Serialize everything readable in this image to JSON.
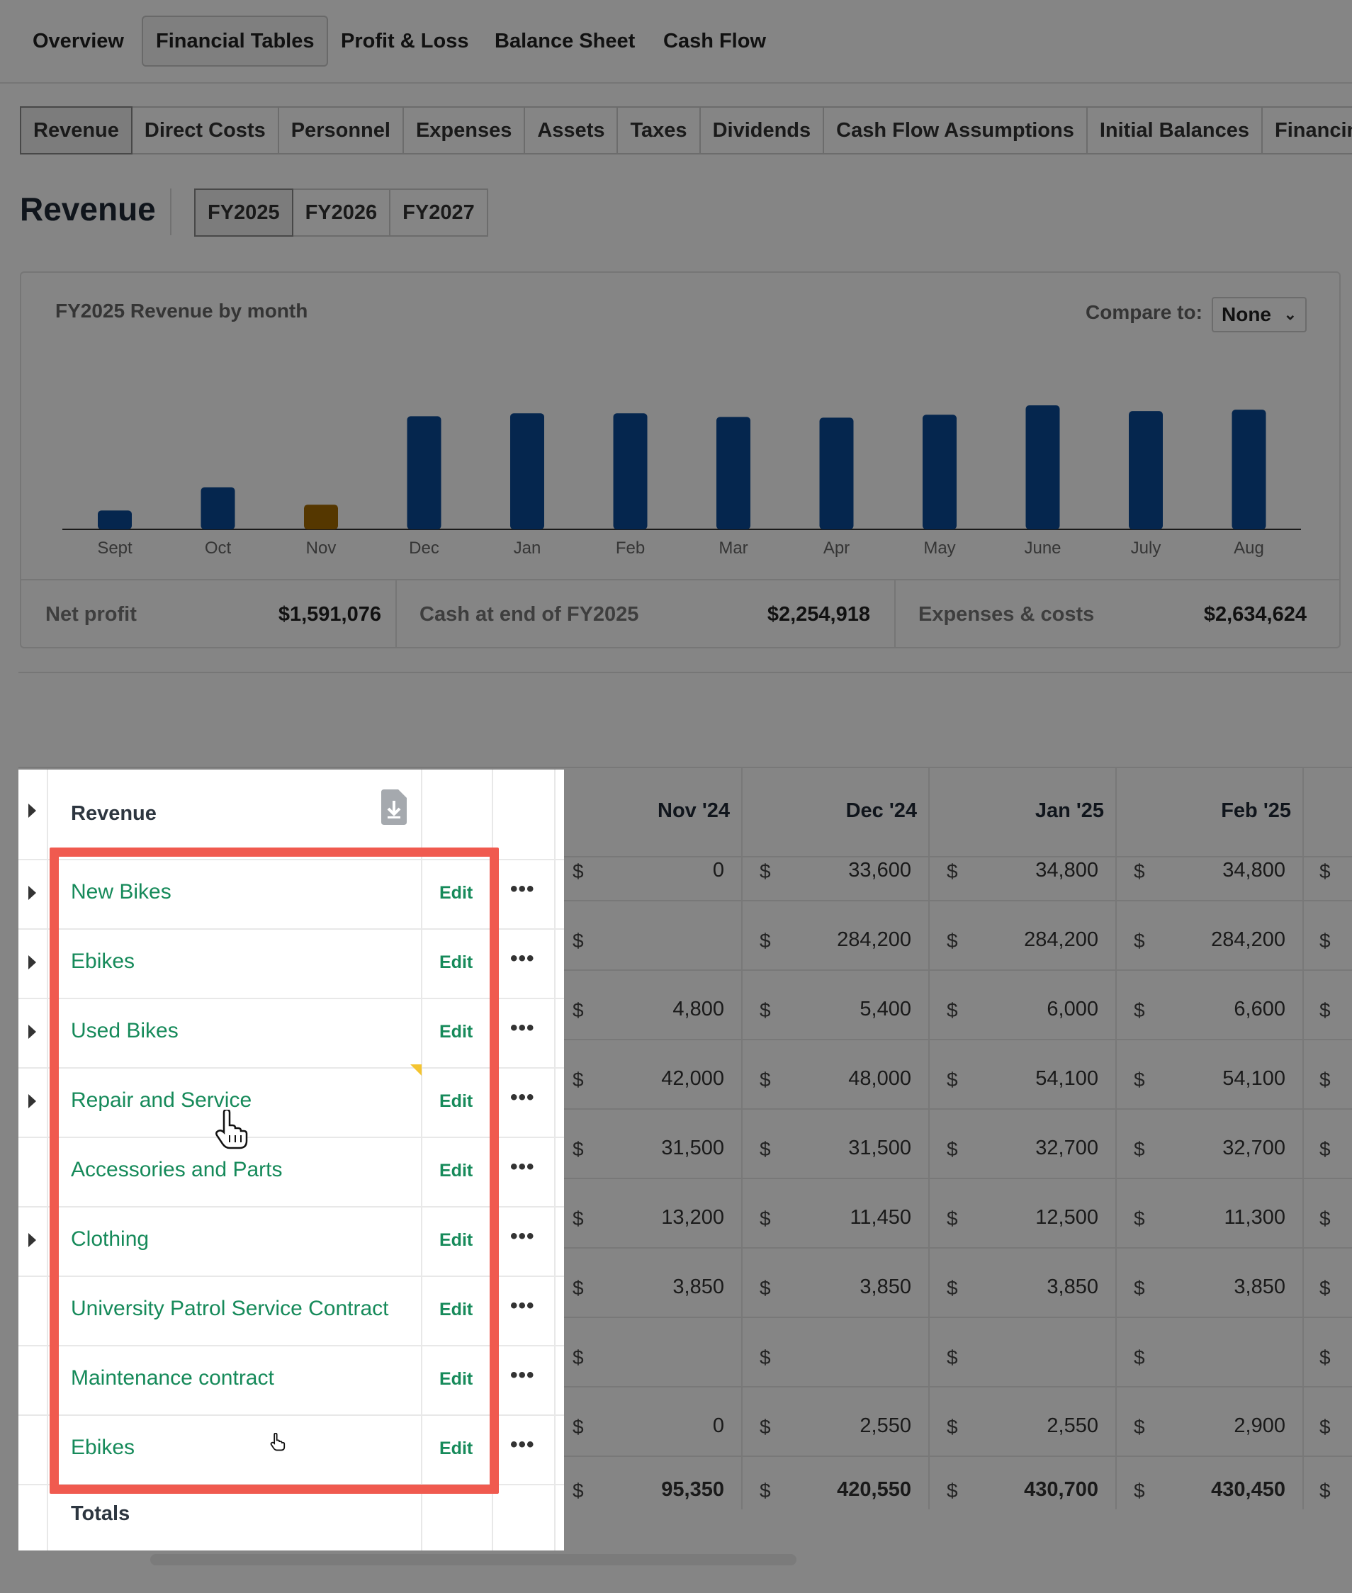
{
  "topnav": [
    {
      "label": "Overview",
      "active": false
    },
    {
      "label": "Financial Tables",
      "active": true
    },
    {
      "label": "Profit & Loss",
      "active": false
    },
    {
      "label": "Balance Sheet",
      "active": false
    },
    {
      "label": "Cash Flow",
      "active": false
    }
  ],
  "subtabs": [
    {
      "label": "Revenue",
      "active": true
    },
    {
      "label": "Direct Costs",
      "active": false
    },
    {
      "label": "Personnel",
      "active": false
    },
    {
      "label": "Expenses",
      "active": false
    },
    {
      "label": "Assets",
      "active": false
    },
    {
      "label": "Taxes",
      "active": false
    },
    {
      "label": "Dividends",
      "active": false
    },
    {
      "label": "Cash Flow Assumptions",
      "active": false
    },
    {
      "label": "Initial Balances",
      "active": false
    },
    {
      "label": "Financing",
      "active": false
    }
  ],
  "heading": "Revenue",
  "fiscal_years": [
    {
      "label": "FY2025",
      "active": true
    },
    {
      "label": "FY2026",
      "active": false
    },
    {
      "label": "FY2027",
      "active": false
    }
  ],
  "chart_card": {
    "title": "FY2025 Revenue by month",
    "compare_label": "Compare to:",
    "compare_value": "None"
  },
  "chart_data": {
    "type": "bar",
    "title": "FY2025 Revenue by month",
    "categories": [
      "Sept",
      "Oct",
      "Nov",
      "Dec",
      "Jan",
      "Feb",
      "Mar",
      "Apr",
      "May",
      "June",
      "July",
      "Aug"
    ],
    "series": [
      {
        "values": [
          26,
          58,
          34,
          156,
          160,
          160,
          155,
          154,
          158,
          171,
          163,
          165
        ]
      }
    ],
    "colors": [
      "#0b4a96",
      "#0b4a96",
      "#a46a00",
      "#0b4a96",
      "#0b4a96",
      "#0b4a96",
      "#0b4a96",
      "#0b4a96",
      "#0b4a96",
      "#0b4a96",
      "#0b4a96",
      "#0b4a96"
    ],
    "xlabel": "",
    "ylabel": "",
    "grid": false,
    "legend": "none"
  },
  "stats": [
    {
      "label": "Net profit",
      "value": "$1,591,076"
    },
    {
      "label": "Cash at end of FY2025",
      "value": "$2,254,918"
    },
    {
      "label": "Expenses & costs",
      "value": "$2,634,624"
    }
  ],
  "table": {
    "header_label": "Revenue",
    "export_icon": "file-download-icon",
    "months": [
      "Nov '24",
      "Dec '24",
      "Jan '25",
      "Feb '25"
    ],
    "currency_symbol": "$",
    "edit_label": "Edit",
    "more_label": "•••",
    "rows": [
      {
        "name": "New Bikes",
        "expandable": true,
        "values": [
          "0",
          "33,600",
          "34,800",
          "34,800"
        ]
      },
      {
        "name": "Ebikes",
        "expandable": true,
        "values": [
          "",
          "284,200",
          "284,200",
          "284,200"
        ]
      },
      {
        "name": "Used Bikes",
        "expandable": true,
        "values": [
          "4,800",
          "5,400",
          "6,000",
          "6,600"
        ]
      },
      {
        "name": "Repair and Service",
        "expandable": true,
        "values": [
          "42,000",
          "48,000",
          "54,100",
          "54,100"
        ]
      },
      {
        "name": "Accessories and Parts",
        "expandable": false,
        "values": [
          "31,500",
          "31,500",
          "32,700",
          "32,700"
        ]
      },
      {
        "name": "Clothing",
        "expandable": true,
        "values": [
          "13,200",
          "11,450",
          "12,500",
          "11,300"
        ]
      },
      {
        "name": "University Patrol Service Contract",
        "expandable": false,
        "values": [
          "3,850",
          "3,850",
          "3,850",
          "3,850"
        ]
      },
      {
        "name": "Maintenance contract",
        "expandable": false,
        "values": [
          "",
          "",
          "",
          ""
        ]
      },
      {
        "name": "Ebikes",
        "expandable": false,
        "values": [
          "0",
          "2,550",
          "2,550",
          "2,900"
        ]
      }
    ],
    "totals_label": "Totals",
    "totals": [
      "95,350",
      "420,550",
      "430,700",
      "430,450"
    ]
  }
}
